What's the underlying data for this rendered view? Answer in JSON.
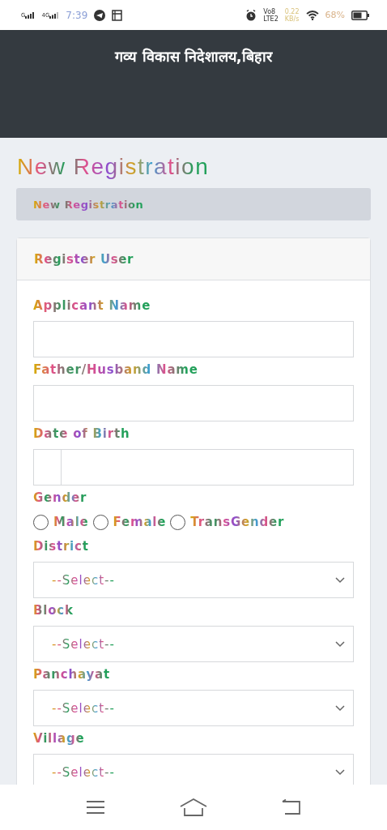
{
  "status_bar": {
    "sim_1": "G",
    "sim_2": "4G",
    "time": "7:39",
    "volte": "Vo8",
    "network": "LTE2",
    "speed": "0.22",
    "speed_unit": "KB/s",
    "battery": "68%"
  },
  "header": {
    "title": "गव्य विकास निदेशालय,बिहार"
  },
  "page_title": "New Registration",
  "breadcrumb": "New Registration",
  "card": {
    "title": "Register User",
    "fields": [
      {
        "kind": "text",
        "label": "Applicant Name"
      },
      {
        "kind": "text",
        "label": "Father/Husband Name"
      },
      {
        "kind": "date",
        "label": "Date of Birth"
      },
      {
        "kind": "radio",
        "label": "Gender",
        "options": [
          {
            "label": "Male",
            "selected": false
          },
          {
            "label": "Female",
            "selected": false
          },
          {
            "label": "TransGender",
            "selected": false
          }
        ]
      },
      {
        "kind": "select",
        "label": "District",
        "value": "--Select--"
      },
      {
        "kind": "select",
        "label": "Block",
        "value": "--Select--"
      },
      {
        "kind": "select",
        "label": "Panchayat",
        "value": "--Select--"
      },
      {
        "kind": "select",
        "label": "Village",
        "value": "--Select--"
      }
    ]
  }
}
